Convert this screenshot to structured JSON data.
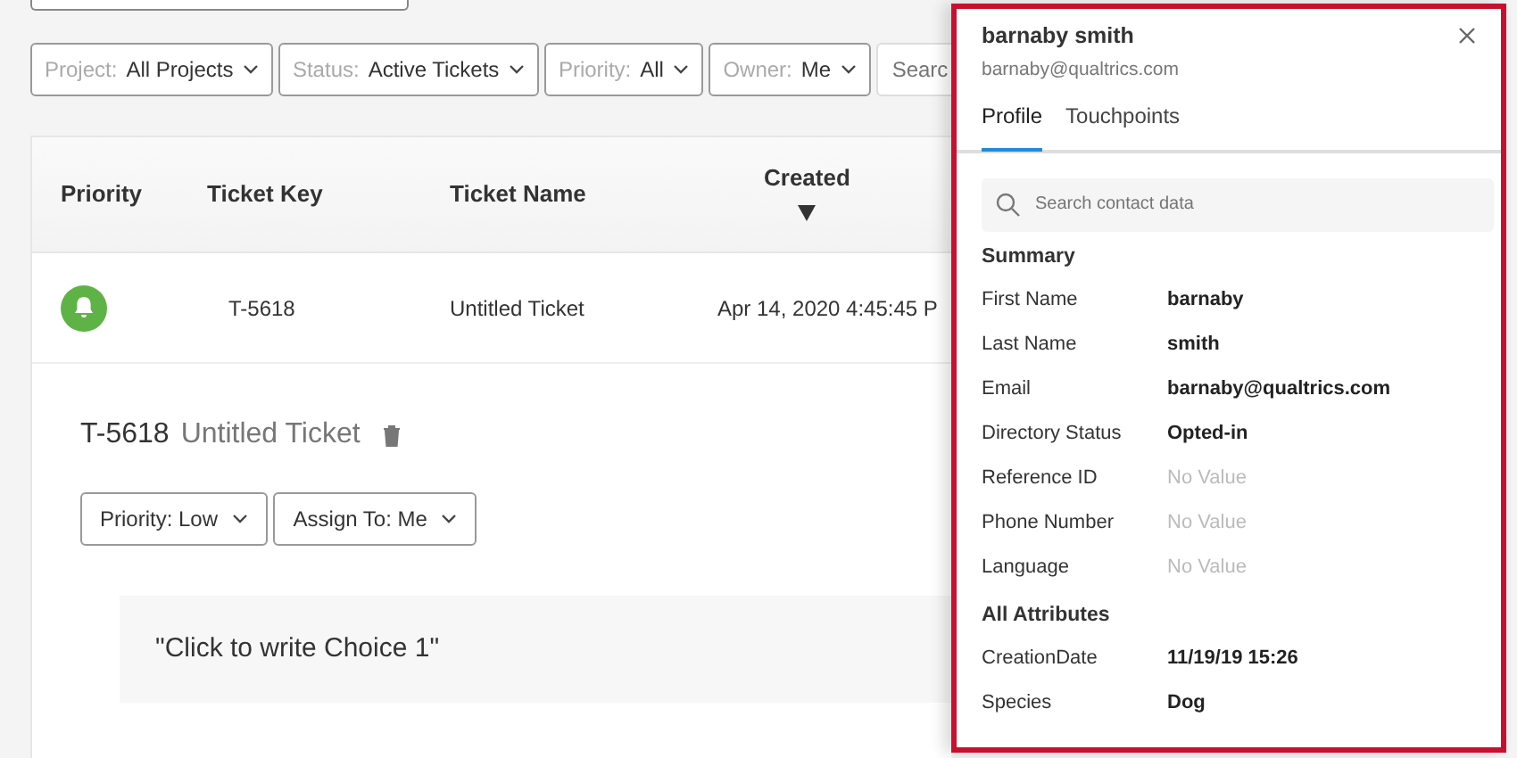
{
  "filters": [
    {
      "label": "Project:",
      "value": "All Projects"
    },
    {
      "label": "Status:",
      "value": "Active Tickets"
    },
    {
      "label": "Priority:",
      "value": "All"
    },
    {
      "label": "Owner:",
      "value": "Me"
    }
  ],
  "filter_search": {
    "placeholder": "Searc"
  },
  "table": {
    "columns": [
      {
        "label": "Priority",
        "sorted": false
      },
      {
        "label": "Ticket Key",
        "sorted": false
      },
      {
        "label": "Ticket Name",
        "sorted": false
      },
      {
        "label": "Created",
        "sorted": true
      }
    ],
    "rows": [
      {
        "key": "T-5618",
        "name": "Untitled Ticket",
        "created": "Apr 14, 2020 4:45:45 P"
      }
    ]
  },
  "ticket": {
    "key": "T-5618",
    "name": "Untitled Ticket",
    "actions": [
      "Priority: Low",
      "Assign To: Me"
    ],
    "choice": "\"Click to write Choice 1\""
  },
  "contact_panel": {
    "name": "barnaby smith",
    "email": "barnaby@qualtrics.com",
    "tabs": [
      {
        "label": "Profile",
        "selected": true
      },
      {
        "label": "Touchpoints",
        "selected": false
      }
    ],
    "search": {
      "placeholder": "Search contact data"
    },
    "sections": [
      {
        "title": "Summary",
        "fields": [
          {
            "label": "First Name",
            "value": "barnaby",
            "empty": false
          },
          {
            "label": "Last Name",
            "value": "smith",
            "empty": false
          },
          {
            "label": "Email",
            "value": "barnaby@qualtrics.com",
            "empty": false
          },
          {
            "label": "Directory Status",
            "value": "Opted-in",
            "empty": false
          },
          {
            "label": "Reference ID",
            "value": "No Value",
            "empty": true
          },
          {
            "label": "Phone Number",
            "value": "No Value",
            "empty": true
          },
          {
            "label": "Language",
            "value": "No Value",
            "empty": true
          }
        ]
      },
      {
        "title": "All Attributes",
        "fields": [
          {
            "label": "CreationDate",
            "value": "11/19/19 15:26",
            "empty": false
          },
          {
            "label": "Species",
            "value": "Dog",
            "empty": false
          }
        ]
      }
    ]
  }
}
